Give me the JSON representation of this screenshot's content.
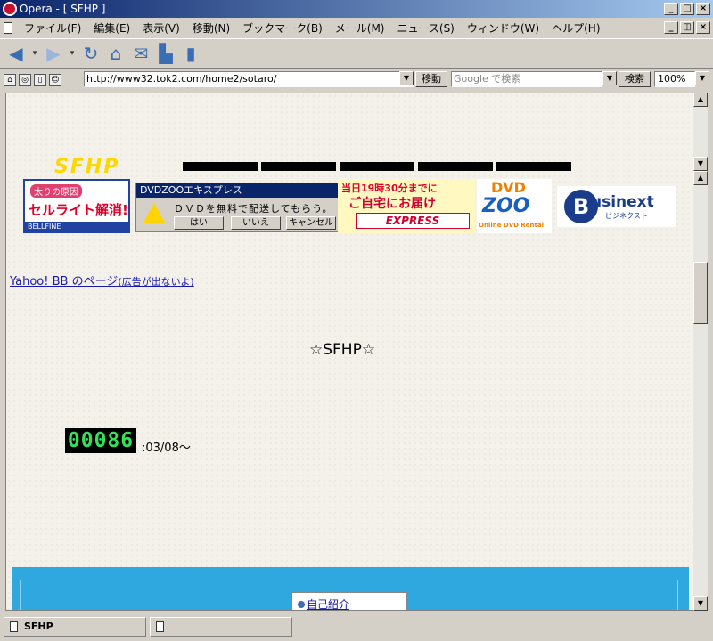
{
  "window": {
    "title": "Opera - [ SFHP ]"
  },
  "menu": {
    "items": [
      "ファイル(F)",
      "編集(E)",
      "表示(V)",
      "移動(N)",
      "ブックマーク(B)",
      "メール(M)",
      "ニュース(S)",
      "ウィンドウ(W)",
      "ヘルプ(H)"
    ]
  },
  "toolbar": {
    "icons": [
      "back-icon",
      "forward-icon",
      "reload-icon",
      "home-icon",
      "hotlist-icon",
      "print-icon",
      "page-icon"
    ]
  },
  "address": {
    "url": "http://www32.tok2.com/home2/sotaro/",
    "go_label": "移動",
    "search_placeholder": "Google で検索",
    "search_label": "検索",
    "zoom": "100%"
  },
  "page": {
    "ads": {
      "bellfine": {
        "pill": "太りの原因",
        "main": "セルライト解消!",
        "foot": "BELLFINE"
      },
      "dvdzoo_dialog": {
        "caption": "DVDZOOエキスプレス",
        "message": "ＤＶＤを無料で配送してもらう。",
        "yes": "はい",
        "no": "いいえ",
        "cancel": "キャンセル"
      },
      "express": {
        "line1": "当日19時30分までに",
        "line2": "ご自宅にお届け",
        "line3": "EXPRESS"
      },
      "dvdzoo": {
        "t1": "DVD",
        "t2": "ZOO",
        "t3": "Online DVD Rental"
      },
      "businext": {
        "letter": "B",
        "name": "usinext",
        "kana": "ビジネクスト"
      }
    },
    "logo_text": "SFHP",
    "yahoo_link": "Yahoo! BB のページ",
    "yahoo_link_note": "(広告が出ないよ)",
    "title": "☆SFHP☆",
    "counter": "00086",
    "since": ":03/08〜",
    "menu_link": "自己紹介"
  },
  "status": {
    "tab_title": "SFHP",
    "empty_tab": ""
  }
}
